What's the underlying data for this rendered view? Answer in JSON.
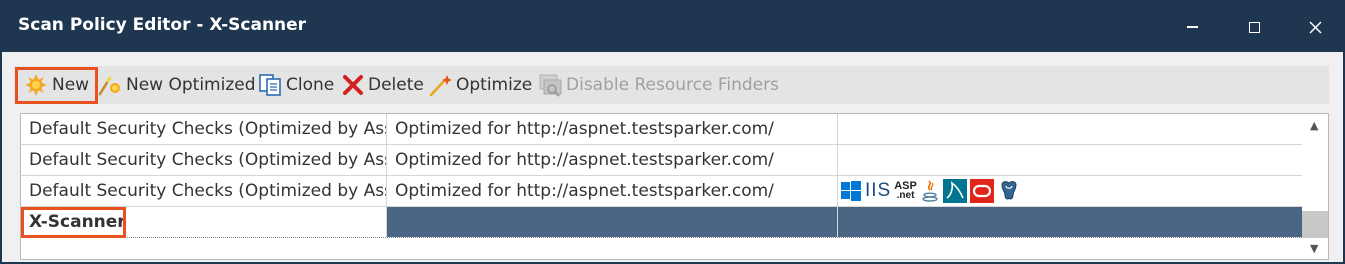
{
  "window": {
    "title": "Scan Policy Editor - X-Scanner"
  },
  "toolbar": {
    "new_label": "New",
    "new_optimized_label": "New Optimized",
    "clone_label": "Clone",
    "delete_label": "Delete",
    "optimize_label": "Optimize",
    "disable_resource_finders_label": "Disable Resource Finders"
  },
  "policies": {
    "rows": [
      {
        "name": "Default Security Checks (Optimized by Ass...",
        "description": "Optimized for http://aspnet.testsparker.com/",
        "technologies": []
      },
      {
        "name": "Default Security Checks (Optimized by Ass...",
        "description": "Optimized for http://aspnet.testsparker.com/",
        "technologies": []
      },
      {
        "name": "Default Security Checks (Optimized by Ass...",
        "description": "Optimized for http://aspnet.testsparker.com/",
        "technologies": [
          "windows-icon",
          "iis-icon",
          "aspnet-icon",
          "java-icon",
          "mysql-icon",
          "oracle-icon",
          "postgresql-icon"
        ]
      },
      {
        "name": "X-Scanner",
        "description": "",
        "technologies": [],
        "selected": true
      }
    ],
    "tech_labels": {
      "iis": "IIS",
      "aspnet_top": "ASP",
      "aspnet_bottom": ".net"
    }
  },
  "colors": {
    "titlebar": "#1e3650",
    "selection": "#4a6584",
    "highlight": "#e8521f"
  }
}
